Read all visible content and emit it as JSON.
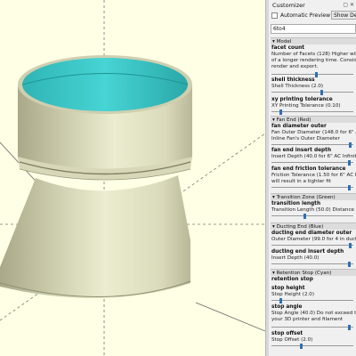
{
  "panel": {
    "title": "Customizer",
    "auto_preview_label": "Automatic Preview",
    "show_details_label": "Show Deta",
    "preset_value": "6to4"
  },
  "sections": {
    "model": "Model",
    "fan_end": "Fan End (Red)",
    "transition_zone": "Transition Zone (Green)",
    "ducting_end": "Ducting End (Blue)",
    "retention_stop": "Retention Stop (Cyan)"
  },
  "params": {
    "facet_count": {
      "label": "facet count",
      "desc": [
        "Number of Facets (128) Higher will in",
        "of a longer rendering time. Consider i",
        "render and export."
      ],
      "level": 0.55
    },
    "shell_thickness": {
      "label": "shell thickness",
      "desc": [
        "Shell Thickness (2.0)"
      ],
      "level": 0.62
    },
    "xy_printing_tolerance": {
      "label": "xy printing tolerance",
      "desc": [
        "XY Printing Tolerance (0.10)"
      ],
      "level": 0.1
    },
    "fan_diameter_outer": {
      "label": "fan diameter outer",
      "desc": [
        "Fan Outer Diameter (148.0 for 6\" AC",
        "Inline Fan's Outer Diameter"
      ],
      "level": 0.98
    },
    "fan_end_insert_depth": {
      "label": "fan end insert depth",
      "desc": [
        "Insert Depth (40.0 for 6\" AC Infinity i"
      ],
      "level": 0.97
    },
    "fan_end_friction_tolerance": {
      "label": "fan end friction tolerance",
      "desc": [
        "Friction Tolerance (1.50 for 6\" AC Inf",
        "will result in a tighter fit"
      ],
      "level": 0.97
    },
    "transition_length": {
      "label": "transition length",
      "desc": [
        "Transition Length (50.0) Distance betw"
      ],
      "level": 0.4
    },
    "ducting_end_diameter_outer": {
      "label": "ducting end diameter outer",
      "desc": [
        "Outer Diameter (99.0 for 4 in ducting"
      ],
      "level": 0.98
    },
    "ducting_end_insert_depth": {
      "label": "ducting end insert depth",
      "desc": [
        "Insert Depth (40.0)"
      ],
      "level": 0.97
    },
    "retention_stop": {
      "label": "retention stop",
      "desc": []
    },
    "stop_height": {
      "label": "stop height",
      "desc": [
        "Stop Height (2.0)"
      ],
      "level": 0.1
    },
    "stop_angle": {
      "label": "stop angle",
      "desc": [
        "Stop Angle (40.0) Do not exceed the",
        "your 3D printer and filament"
      ],
      "level": 0.97
    },
    "stop_offset": {
      "label": "stop offset",
      "desc": [
        "Stop Offset (2.0)"
      ],
      "level": 0.36
    }
  },
  "colors": {
    "model_surface": "#e8e8c8",
    "model_shadow": "#a9a98a",
    "interior_cyan": "#33c6c6",
    "viewport_bg": "#ffffe5",
    "slider_thumb": "#2f6fb3"
  }
}
